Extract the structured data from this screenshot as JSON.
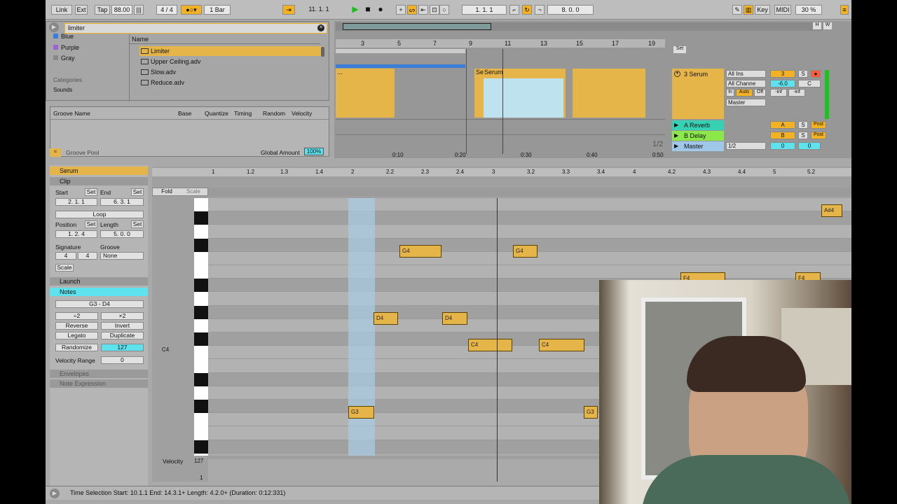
{
  "topbar": {
    "link": "Link",
    "ext": "Ext",
    "tap": "Tap",
    "tempo": "88.00",
    "sig": "4 / 4",
    "quant": "1 Bar",
    "pos": "11.   1.   1",
    "loop_start": "1.   1.   1",
    "loop_len": "8.   0.   0",
    "key": "Key",
    "midi": "MIDI",
    "cpu": "30 %"
  },
  "browser": {
    "search": "limiter",
    "colors": [
      "Blue",
      "Purple",
      "Gray"
    ],
    "categories_label": "Categories",
    "sounds": "Sounds",
    "name_header": "Name",
    "files": [
      "Limiter",
      "Upper Ceiling.adv",
      "Slow.adv",
      "Reduce.adv"
    ]
  },
  "groove": {
    "headers": [
      "Groove Name",
      "Base",
      "Quantize",
      "Timing",
      "Random",
      "Velocity"
    ],
    "pool": "Groove Pool",
    "global_amount_label": "Global Amount",
    "global_amount": "100%"
  },
  "arrangement": {
    "bar_labels": [
      "3",
      "5",
      "7",
      "9",
      "11",
      "13",
      "15",
      "17",
      "19"
    ],
    "set": "Set",
    "time_labels": [
      "0:10",
      "0:20",
      "0:30",
      "0:40",
      "0:50"
    ],
    "page": "1/2",
    "clip_name_1": "Se",
    "clip_name_2": "Serum",
    "clip_name_0": "...",
    "tracks": [
      {
        "name": "3 Serum",
        "input": "All Ins",
        "channel": "All Channe",
        "output": "Master",
        "num": "3",
        "vol": "-6.0",
        "pan": "C",
        "in": "In",
        "auto": "Auto",
        "off": "Off",
        "inf1": "-inf",
        "inf2": "-inf"
      },
      {
        "name": "A Reverb",
        "letter": "A",
        "post": "Post"
      },
      {
        "name": "B Delay",
        "letter": "B",
        "post": "Post"
      },
      {
        "name": "Master",
        "cue": "1/2",
        "vol": "0",
        "pan": "0"
      }
    ]
  },
  "clip": {
    "title": "Serum",
    "clip": "Clip",
    "start": "Start",
    "end": "End",
    "set": "Set",
    "start_val": "2.   1.   1",
    "end_val": "6.   3.   1",
    "loop": "Loop",
    "position": "Position",
    "length": "Length",
    "pos_val": "1.   2.   4",
    "len_val": "5.   0.   0",
    "signature": "Signature",
    "groove": "Groove",
    "sig_num": "4",
    "sig_den": "4",
    "groove_val": "None",
    "scale": "Scale",
    "launch": "Launch",
    "notes": "Notes",
    "range": "G3 - D4",
    "div2": "÷2",
    "mul2": "×2",
    "reverse": "Reverse",
    "invert": "Invert",
    "legato": "Legato",
    "duplicate": "Duplicate",
    "randomize": "Randomize",
    "rand_val": "127",
    "vel_range": "Velocity Range",
    "vel_range_val": "0",
    "envelopes": "Envelopes",
    "note_expression": "Note Expression"
  },
  "roll": {
    "ruler": [
      "1",
      "1.2",
      "1.3",
      "1.4",
      "2",
      "2.2",
      "2.3",
      "2.4",
      "3",
      "3.2",
      "3.3",
      "3.4",
      "4",
      "4.2",
      "4.3",
      "4.4",
      "5",
      "5.2"
    ],
    "fold": "Fold",
    "scale": "Scale",
    "c4": "C4",
    "velocity": "Velocity",
    "v127": "127",
    "v1": "1",
    "notes": [
      {
        "label": "A#4"
      },
      {
        "label": "G4"
      },
      {
        "label": "G4"
      },
      {
        "label": "F4"
      },
      {
        "label": "F4"
      },
      {
        "label": "D4"
      },
      {
        "label": "D4"
      },
      {
        "label": "C4"
      },
      {
        "label": "C4"
      },
      {
        "label": "G3"
      },
      {
        "label": "G3"
      }
    ]
  },
  "status": {
    "text": "Time Selection   Start: 10.1.1   End: 14.3.1+   Length: 4.2.0+   (Duration: 0:12:331)"
  }
}
